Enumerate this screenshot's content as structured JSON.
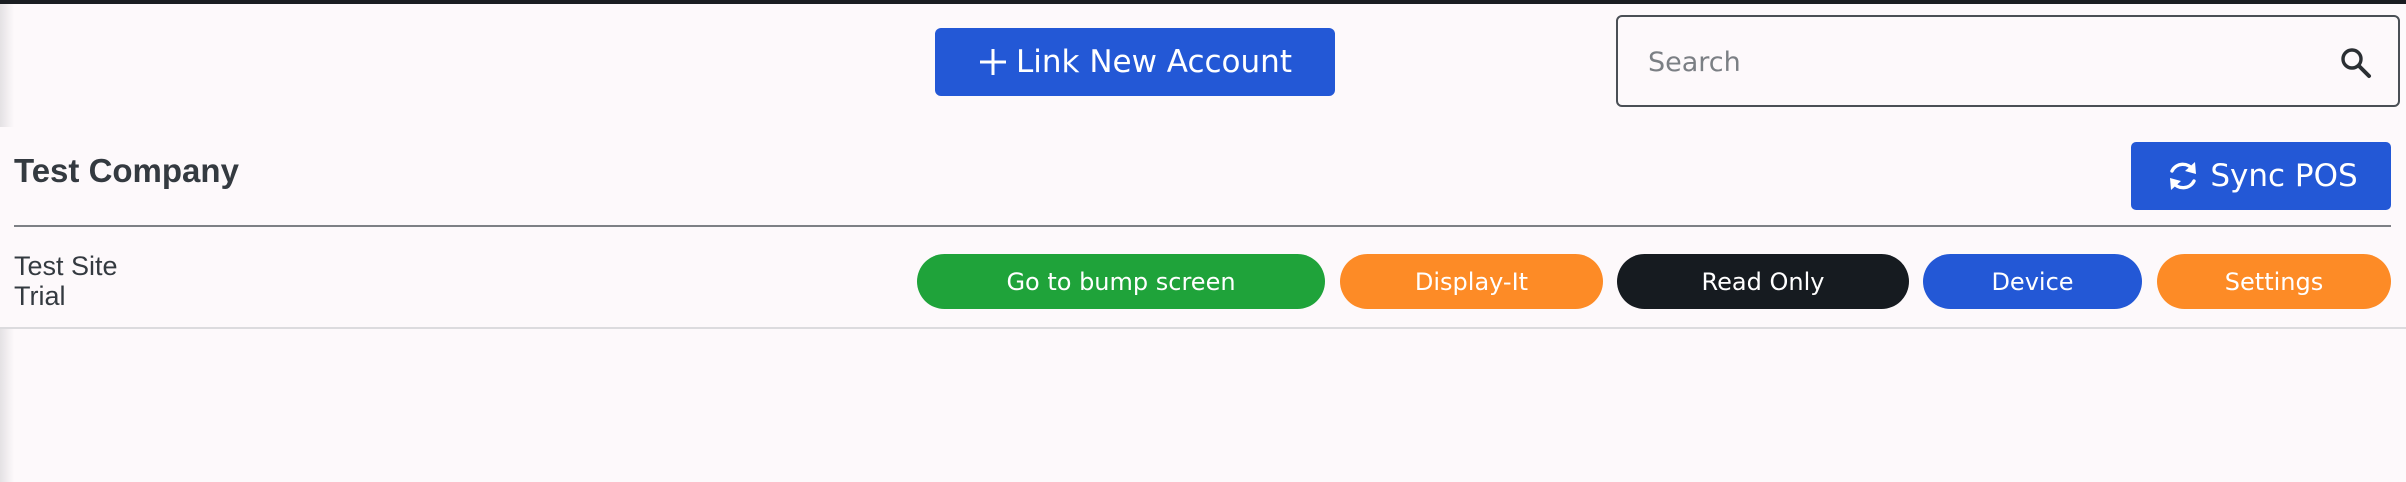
{
  "header": {
    "link_account_label": "Link New Account",
    "search": {
      "placeholder": "Search",
      "value": ""
    }
  },
  "company": {
    "name": "Test Company",
    "sync_label": "Sync POS"
  },
  "site": {
    "name": "Test Site",
    "plan": "Trial",
    "actions": {
      "bump_label": "Go to bump screen",
      "display_label": "Display-It",
      "readonly_label": "Read Only",
      "device_label": "Device",
      "settings_label": "Settings"
    }
  },
  "colors": {
    "primary": "#2358d6",
    "success": "#1fa33a",
    "warning": "#fd8b26",
    "dark": "#161b20",
    "background": "#fdf9fb"
  },
  "icons": {
    "link_button": "plus-icon",
    "search": "search-icon",
    "sync_button": "sync-icon"
  }
}
